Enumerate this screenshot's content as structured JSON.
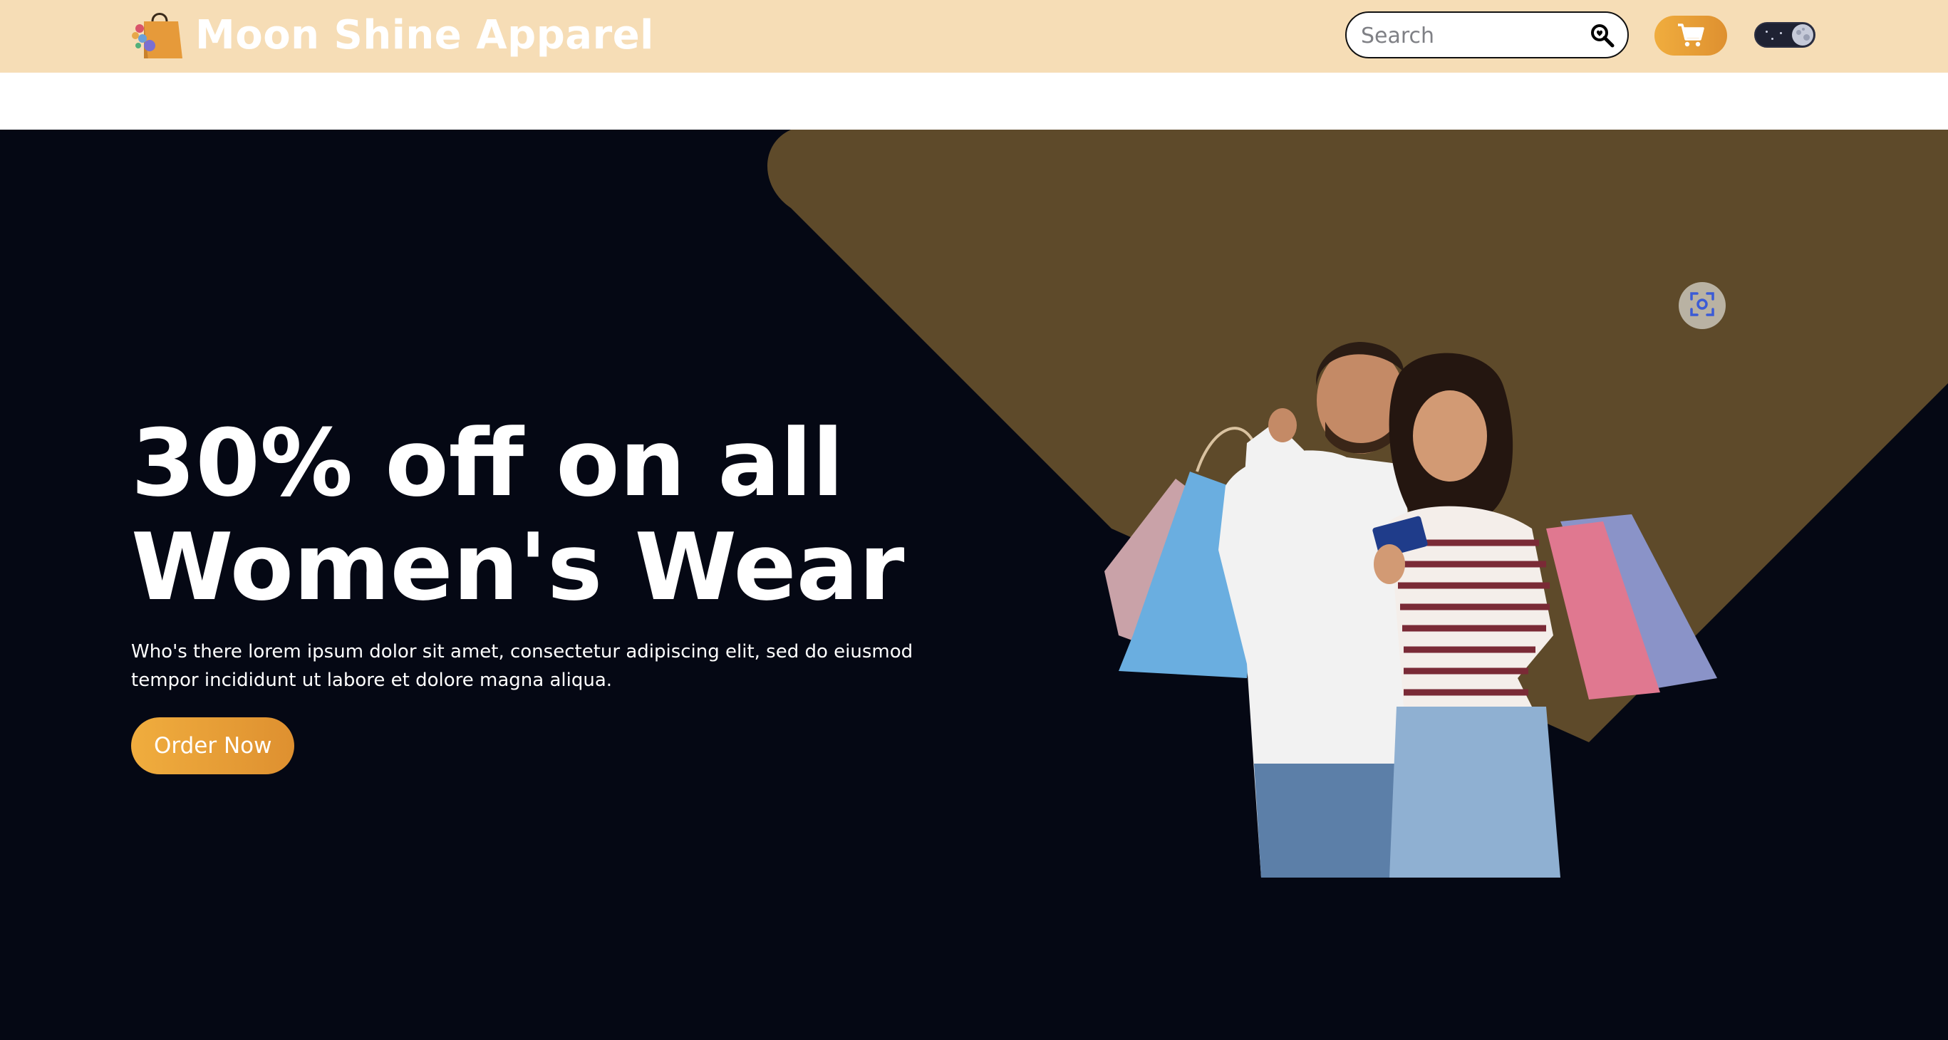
{
  "brand": {
    "name": "Moon Shine Apparel",
    "logo_icon": "shopping-bag-icon",
    "logo_color": "#e69a3a"
  },
  "search": {
    "placeholder": "Search",
    "value": "",
    "icon": "search-icon"
  },
  "cart": {
    "icon": "cart-icon",
    "color": "#e9a33a"
  },
  "theme_toggle": {
    "icon": "moon-icon",
    "mode": "dark"
  },
  "hero": {
    "title_line1": "30% off on all",
    "title_line2": "Women's Wear",
    "description": "Who's there lorem ipsum dolor sit amet, consectetur adipiscing elit, sed do eiusmod tempor incididunt ut labore et dolore magna aliqua.",
    "cta_label": "Order Now",
    "image_subject": "couple-holding-shopping-bags",
    "lens_icon": "visual-search-icon",
    "background_color": "#050814",
    "shape_color": "#5e4a2a"
  },
  "colors": {
    "navbar": "#f6ddb6",
    "accent": "#e9a33a",
    "text_light": "#ffffff"
  }
}
